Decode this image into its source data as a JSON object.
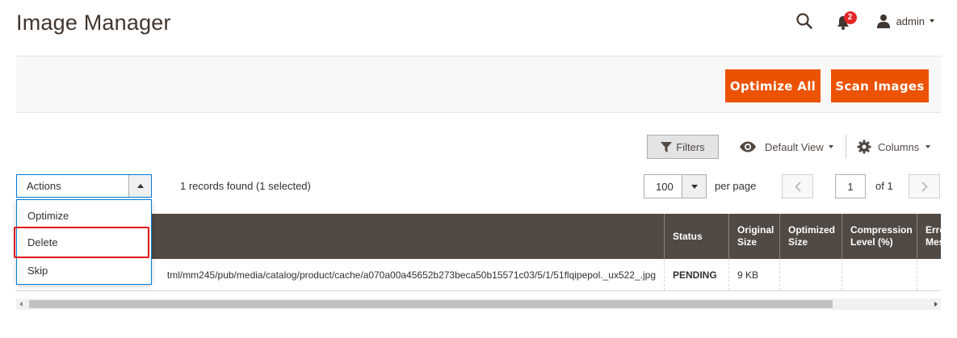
{
  "page": {
    "title": "Image Manager"
  },
  "header": {
    "notifications_count": "2",
    "user_name": "admin"
  },
  "action_bar": {
    "optimize_all_label": "Optimize All",
    "scan_images_label": "Scan Images",
    "accent_color": "#eb5202"
  },
  "toolbar": {
    "filters_label": "Filters",
    "view_label": "Default View",
    "columns_label": "Columns"
  },
  "mass_actions": {
    "selected_label": "Actions",
    "options": [
      "Optimize",
      "Delete",
      "Skip"
    ],
    "highlighted_option": "Delete"
  },
  "records": {
    "summary": "1 records found (1 selected)"
  },
  "pagination": {
    "per_page_value": "100",
    "per_page_label": "per page",
    "current_page": "1",
    "total_label": "of 1"
  },
  "grid": {
    "columns": [
      "Status",
      "Original Size",
      "Optimized Size",
      "Compression Level (%)",
      "Error Message"
    ],
    "column_display": [
      "Status",
      "Original\nSize",
      "Optimized\nSize",
      "Compression\nLevel (%)",
      "Erro\nMes"
    ],
    "rows": [
      {
        "path": "tml/mm245/pub/media/catalog/product/cache/a070a00a45652b273beca50b15571c03/5/1/51flqipepol._ux522_.jpg",
        "status": "PENDING",
        "original_size": "9 KB",
        "optimized_size": "",
        "compression_level": "",
        "error_message": ""
      }
    ]
  }
}
